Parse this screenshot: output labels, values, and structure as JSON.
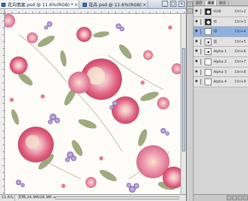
{
  "document": {
    "tabs": [
      {
        "label": "花卉图案.psd @ 11.6%(RGB) *",
        "active": true
      },
      {
        "label": "花卉.psd @ 11.6%(RGB)",
        "active": false
      }
    ],
    "window_buttons": {
      "minimize": "_",
      "maximize": "□",
      "close": "×"
    }
  },
  "statusbar": {
    "zoom": "11.6%",
    "doc_info": "文档:24.9M/26.9M"
  },
  "layers_panel": {
    "tabs": [
      "图层",
      "通道",
      "路径"
    ],
    "layers": [
      {
        "name": "RGB",
        "shortcut": "Ctrl+2",
        "thumb": "dark",
        "active": false
      },
      {
        "name": "红",
        "shortcut": "Ctrl+3",
        "thumb": "dark",
        "active": false
      },
      {
        "name": "绿",
        "shortcut": "Ctrl+4",
        "thumb": "white",
        "active": true
      },
      {
        "name": "蓝",
        "shortcut": "Ctrl+5",
        "thumb": "dot",
        "active": false
      },
      {
        "name": "Alpha 1",
        "shortcut": "Ctrl+6",
        "thumb": "dot",
        "active": false
      },
      {
        "name": "Alpha 2",
        "shortcut": "Ctrl+7",
        "thumb": "white",
        "active": false
      },
      {
        "name": "Alpha 3",
        "shortcut": "Ctrl+8",
        "thumb": "white",
        "active": false
      },
      {
        "name": "Alpha 4",
        "shortcut": "Ctrl+9",
        "thumb": "white",
        "active": false
      }
    ]
  },
  "colors": {
    "rose": "#e2607f",
    "rose_light": "#f2a5b8",
    "cream": "#f4e6c4",
    "leaf": "#8a9a6a",
    "lilac": "#9b7fc0",
    "selection": "#8fb2e2"
  }
}
